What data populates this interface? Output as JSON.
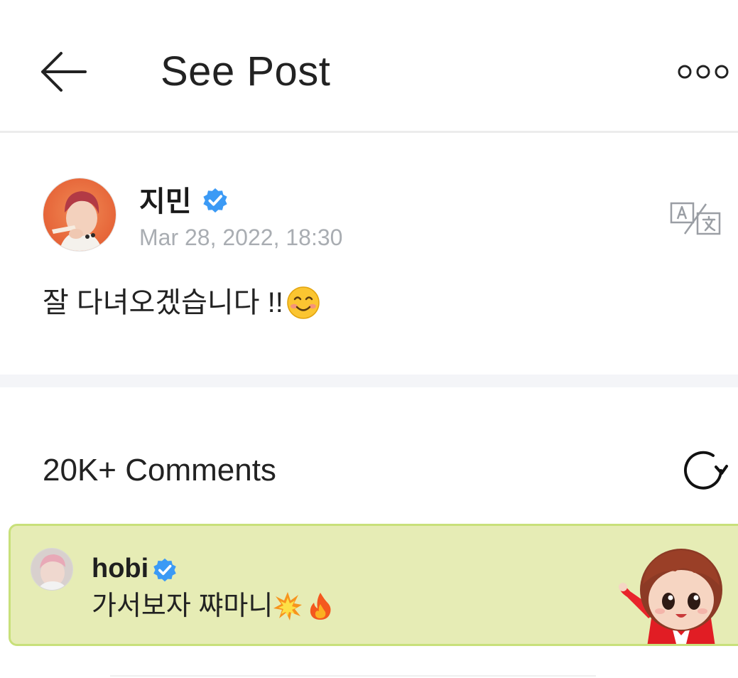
{
  "header": {
    "title": "See Post",
    "back_icon": "arrow-left-icon",
    "more_icon": "more-dots-icon"
  },
  "post": {
    "author": "지민",
    "verified": true,
    "timestamp": "Mar 28, 2022, 18:30",
    "text": "잘 다녀오겠습니다 !!",
    "emoji": "smiling-face-icon",
    "translate_icon": "translate-icon"
  },
  "comments": {
    "count_label": "20K+ Comments",
    "refresh_icon": "refresh-icon",
    "items": [
      {
        "author": "hobi",
        "verified": true,
        "text": "가서보자 쨔마니",
        "emojis": [
          "collision-icon",
          "fire-icon"
        ]
      }
    ]
  },
  "colors": {
    "verified_blue": "#3b9af5",
    "comment_background": "#e6ecb5",
    "comment_border": "#c8e07a",
    "timestamp_gray": "#a9adb2",
    "section_gap": "#f4f5f8"
  }
}
